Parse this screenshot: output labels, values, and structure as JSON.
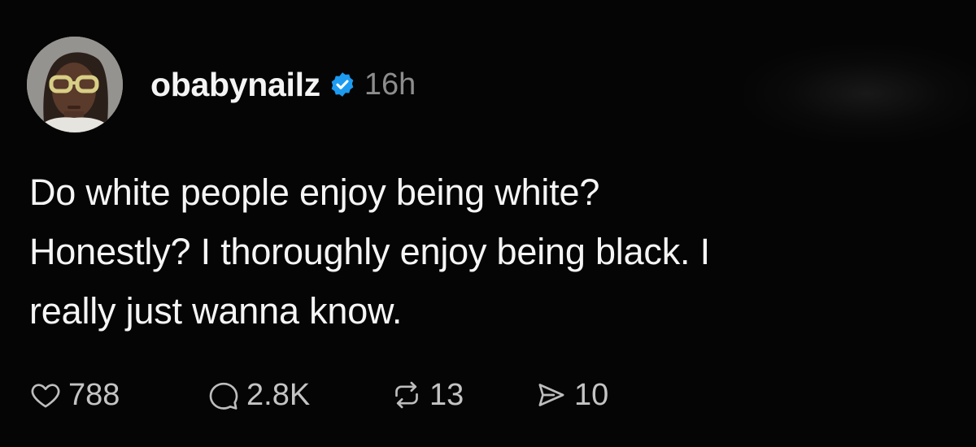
{
  "post": {
    "author": {
      "username": "obabynailz",
      "verified": true,
      "timestamp": "16h",
      "avatar_icon": "profile-photo"
    },
    "text_lines": [
      "Do white people enjoy being white?",
      "Honestly? I thoroughly enjoy being black. I",
      "really just wanna know."
    ],
    "actions": {
      "likes": "788",
      "replies": "2.8K",
      "reposts": "13",
      "shares": "10"
    }
  },
  "colors": {
    "background": "#050505",
    "text": "#f5f5f5",
    "muted": "#8d8d8d",
    "verified_badge": "#1d9bf0"
  }
}
